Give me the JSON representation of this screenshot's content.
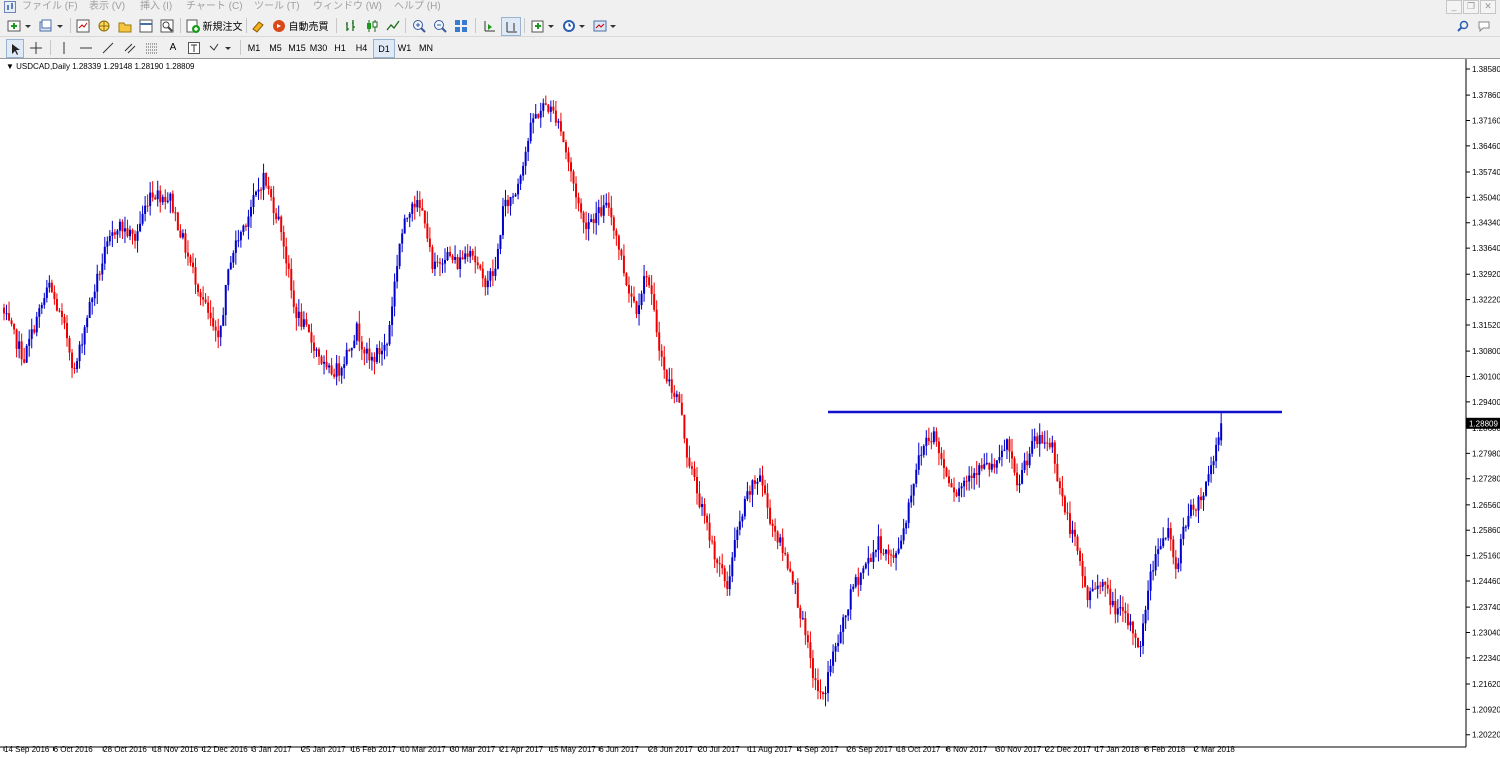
{
  "menu": [
    "ファイル (F)",
    "表示 (V)",
    "挿入 (I)",
    "チャート (C)",
    "ツール (T)",
    "ウィンドウ (W)",
    "ヘルプ (H)"
  ],
  "toolbar": {
    "new_order_label": "新規注文",
    "auto_trade_label": "自動売買"
  },
  "timeframes": [
    {
      "label": "M1",
      "active": false
    },
    {
      "label": "M5",
      "active": false
    },
    {
      "label": "M15",
      "active": false
    },
    {
      "label": "M30",
      "active": false
    },
    {
      "label": "H1",
      "active": false
    },
    {
      "label": "H4",
      "active": false
    },
    {
      "label": "D1",
      "active": true
    },
    {
      "label": "W1",
      "active": false
    },
    {
      "label": "MN",
      "active": false
    }
  ],
  "chart": {
    "symbol_info": "USDCAD,Daily  1.28339 1.29148 1.28190 1.28809",
    "current_price_label": "1.28809",
    "current_price": 1.28809,
    "resistance_level": 1.2912,
    "colors": {
      "bull": "#0000cc",
      "bear": "#ee0000",
      "line": "#1010cc",
      "axis": "#000000"
    }
  },
  "chart_data": {
    "type": "candlestick",
    "symbol": "USDCAD",
    "timeframe": "Daily",
    "ohlc_last": {
      "open": 1.28339,
      "high": 1.29148,
      "low": 1.2819,
      "close": 1.28809
    },
    "ylim": [
      1.2002,
      1.3858
    ],
    "y_ticks": [
      "1.38580",
      "1.37860",
      "1.37160",
      "1.36460",
      "1.35740",
      "1.35040",
      "1.34340",
      "1.33640",
      "1.32920",
      "1.32220",
      "1.31520",
      "1.30800",
      "1.30100",
      "1.29400",
      "1.28680",
      "1.27980",
      "1.27280",
      "1.26560",
      "1.25860",
      "1.25160",
      "1.24460",
      "1.23740",
      "1.23040",
      "1.22340",
      "1.21620",
      "1.20920",
      "1.20220"
    ],
    "x_ticks": [
      "14 Sep 2016",
      "6 Oct 2016",
      "28 Oct 2016",
      "18 Nov 2016",
      "12 Dec 2016",
      "3 Jan 2017",
      "25 Jan 2017",
      "16 Feb 2017",
      "10 Mar 2017",
      "30 Mar 2017",
      "21 Apr 2017",
      "15 May 2017",
      "6 Jun 2017",
      "28 Jun 2017",
      "20 Jul 2017",
      "11 Aug 2017",
      "4 Sep 2017",
      "26 Sep 2017",
      "18 Oct 2017",
      "8 Nov 2017",
      "30 Nov 2017",
      "22 Dec 2017",
      "17 Jan 2018",
      "8 Feb 2018",
      "2 Mar 2018"
    ],
    "anchors": [
      [
        0,
        1.318
      ],
      [
        8,
        1.306
      ],
      [
        12,
        1.315
      ],
      [
        18,
        1.326
      ],
      [
        25,
        1.312
      ],
      [
        28,
        1.302
      ],
      [
        33,
        1.318
      ],
      [
        40,
        1.335
      ],
      [
        45,
        1.343
      ],
      [
        52,
        1.339
      ],
      [
        58,
        1.352
      ],
      [
        66,
        1.35
      ],
      [
        73,
        1.334
      ],
      [
        80,
        1.32
      ],
      [
        85,
        1.31
      ],
      [
        90,
        1.334
      ],
      [
        100,
        1.351
      ],
      [
        103,
        1.356
      ],
      [
        110,
        1.342
      ],
      [
        115,
        1.32
      ],
      [
        125,
        1.307
      ],
      [
        128,
        1.302
      ],
      [
        133,
        1.303
      ],
      [
        140,
        1.314
      ],
      [
        145,
        1.305
      ],
      [
        152,
        1.31
      ],
      [
        157,
        1.338
      ],
      [
        162,
        1.35
      ],
      [
        167,
        1.345
      ],
      [
        170,
        1.33
      ],
      [
        175,
        1.335
      ],
      [
        180,
        1.332
      ],
      [
        185,
        1.337
      ],
      [
        190,
        1.327
      ],
      [
        195,
        1.33
      ],
      [
        198,
        1.347
      ],
      [
        203,
        1.352
      ],
      [
        210,
        1.372
      ],
      [
        215,
        1.376
      ],
      [
        220,
        1.372
      ],
      [
        225,
        1.357
      ],
      [
        230,
        1.343
      ],
      [
        240,
        1.348
      ],
      [
        243,
        1.34
      ],
      [
        247,
        1.327
      ],
      [
        251,
        1.32
      ],
      [
        255,
        1.33
      ],
      [
        258,
        1.318
      ],
      [
        262,
        1.302
      ],
      [
        268,
        1.294
      ],
      [
        271,
        1.28
      ],
      [
        277,
        1.264
      ],
      [
        283,
        1.25
      ],
      [
        287,
        1.243
      ],
      [
        290,
        1.255
      ],
      [
        295,
        1.268
      ],
      [
        300,
        1.274
      ],
      [
        304,
        1.262
      ],
      [
        309,
        1.253
      ],
      [
        313,
        1.246
      ],
      [
        318,
        1.229
      ],
      [
        322,
        1.216
      ],
      [
        325,
        1.212
      ],
      [
        328,
        1.222
      ],
      [
        332,
        1.23
      ],
      [
        337,
        1.243
      ],
      [
        341,
        1.248
      ],
      [
        347,
        1.255
      ],
      [
        353,
        1.25
      ],
      [
        357,
        1.259
      ],
      [
        362,
        1.276
      ],
      [
        366,
        1.284
      ],
      [
        369,
        1.285
      ],
      [
        373,
        1.276
      ],
      [
        378,
        1.269
      ],
      [
        384,
        1.275
      ],
      [
        390,
        1.276
      ],
      [
        394,
        1.276
      ],
      [
        398,
        1.283
      ],
      [
        402,
        1.27
      ],
      [
        405,
        1.277
      ],
      [
        409,
        1.283
      ],
      [
        413,
        1.283
      ],
      [
        416,
        1.282
      ],
      [
        418,
        1.274
      ],
      [
        421,
        1.264
      ],
      [
        425,
        1.255
      ],
      [
        430,
        1.24
      ],
      [
        435,
        1.245
      ],
      [
        440,
        1.238
      ],
      [
        444,
        1.235
      ],
      [
        448,
        1.231
      ],
      [
        451,
        1.226
      ],
      [
        454,
        1.243
      ],
      [
        458,
        1.255
      ],
      [
        462,
        1.258
      ],
      [
        465,
        1.247
      ],
      [
        468,
        1.26
      ],
      [
        472,
        1.265
      ],
      [
        476,
        1.269
      ],
      [
        480,
        1.279
      ],
      [
        483,
        1.288
      ]
    ]
  }
}
